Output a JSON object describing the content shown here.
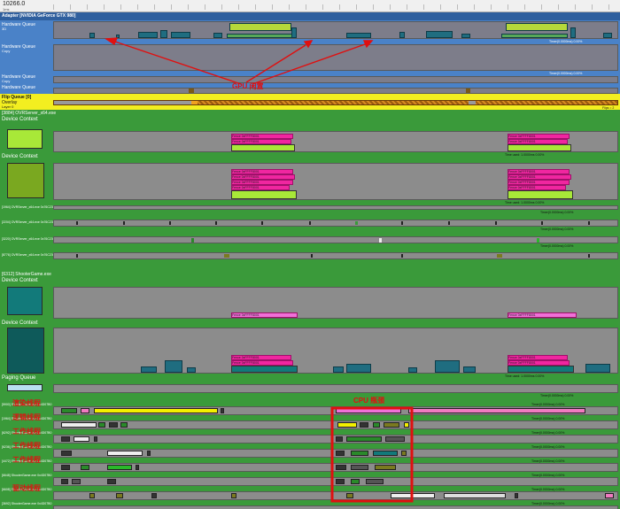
{
  "header": {
    "title": "10266.0",
    "unit": "1ms"
  },
  "adapter": {
    "title": "Adapter [NVIDIA GeForce GTX 980]",
    "queues": [
      {
        "name": "Hardware Queue",
        "sub": "3D",
        "stat": "Timer(0.0000ms) 0.00%"
      },
      {
        "name": "Hardware Queue",
        "sub": "Copy",
        "stat": "Timer(0.0000ms) 0.00%"
      },
      {
        "name": "Hardware Queue",
        "sub": "Copy",
        "stat": "Timer(0.0000ms) 0.00%"
      },
      {
        "name": "Hardware Queue",
        "sub": "Compute",
        "stat": "Timer(1.0000ms) 0.00%"
      }
    ]
  },
  "flip": {
    "title": "Flip Queue [0]",
    "row": "Overlay",
    "sub": "Layer 0",
    "stat": "Flips = 2"
  },
  "ovr": {
    "title": "[3884] OVRServer_x64.exe",
    "ctx_label": "Device Context",
    "ctx1_stat": "Time used: 1.0000ms 0.00%",
    "ctx2_stat": "Time used: 1.0000ms 0.00%",
    "tag_text": "Fence 0xFFFF8001",
    "threads": [
      {
        "name": "[1964] OVRServer_x64.exe 0x76C230",
        "stat": "Timer(0.0000ms) 0.00%"
      },
      {
        "name": "[2204] OVRServer_x64.exe 0x76C230",
        "stat": "Timer(0.0000ms) 0.00%"
      },
      {
        "name": "[3220] OVRServer_x64.exe 0x76C230",
        "stat": "Timer(0.0000ms) 0.00%"
      },
      {
        "name": "[8776] OVRServer_x64.exe 0x76C230",
        "stat": "Timer(0.0000ms) 0.00%"
      }
    ]
  },
  "shooter": {
    "title": "[6312] ShooterGame.exe",
    "ctx_label": "Device Context",
    "ctx1_stat": "Time used: 1.0000ms 0.00%",
    "ctx2_stat": "Time used: 1.0000ms 0.00%",
    "tag_text": "Fence 0xFFFF8001",
    "paging": "Paging Queue",
    "paging_stat": "Timer(0.0000ms) 0.00%",
    "threads": [
      {
        "name": "[5900] ShooterGame.exe 0x4D07B0",
        "stat": "Timer(0.0000ms) 0.00%"
      },
      {
        "name": "[1964] ShooterGame.exe 0x4D07B0",
        "stat": "Timer(0.0000ms) 0.00%"
      },
      {
        "name": "[6292] ShooterGame.exe 0x4D07B0",
        "stat": "Timer(0.0000ms) 0.00%"
      },
      {
        "name": "[6236] ShooterGame.exe 0x4D07B0",
        "stat": "Timer(0.0000ms) 0.00%"
      },
      {
        "name": "[4472] ShooterGame.exe 0x4D07B0",
        "stat": "Timer(0.0000ms) 0.00%"
      },
      {
        "name": "[6648] ShooterGame.exe 0x4D07B0",
        "stat": "Timer(0.0000ms) 0.00%"
      },
      {
        "name": "[6608] ShooterGame.exe 0x4D07B0",
        "stat": "Timer(0.0000ms) 0.00%"
      },
      {
        "name": "[3692] ShooterGame.exe 0x4D07B0",
        "stat": "Timer(0.0000ms) 0.00%"
      },
      {
        "name": "[2460] nvogl32um.dll 0x6D4C8",
        "stat": "Timer(0.0000ms) 0.00%"
      }
    ]
  },
  "annotations": {
    "gpu": "GPU 闲置",
    "cpu": "CPU 瓶颈",
    "render": "渲染线程",
    "logic": "逻辑线程",
    "worker1": "工作线程",
    "worker2": "工作线程",
    "worker3": "工作线程",
    "driver": "驱动线程"
  },
  "colors": {
    "header_bg": "#f0f0f0",
    "adapter_bg": "#4a82c8",
    "flip_bg": "#f3ee20",
    "process_bg": "#3a9a3a",
    "annotation": "#e01010"
  }
}
